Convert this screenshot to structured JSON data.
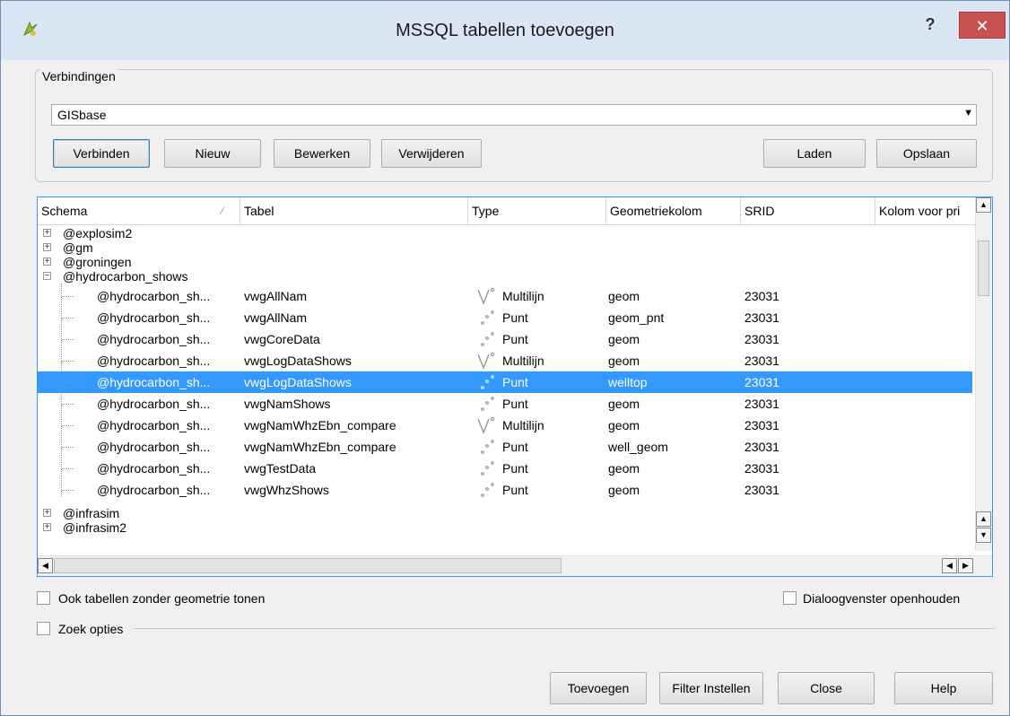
{
  "window": {
    "title": "MSSQL tabellen toevoegen",
    "help_label": "?",
    "close_label": "✕"
  },
  "connections": {
    "legend": "Verbindingen",
    "selected": "GISbase",
    "buttons": {
      "connect": "Verbinden",
      "new": "Nieuw",
      "edit": "Bewerken",
      "delete": "Verwijderen",
      "load": "Laden",
      "save": "Opslaan"
    }
  },
  "table": {
    "columns": [
      "Schema",
      "Tabel",
      "Type",
      "Geometriekolom",
      "SRID",
      "Kolom voor pri"
    ],
    "groups_before": [
      "@explosim2",
      "@gm",
      "@groningen"
    ],
    "expanded_group": "@hydrocarbon_shows",
    "rows": [
      {
        "schema": "@hydrocarbon_sh...",
        "tabel": "vwgAllNam",
        "type": "Multilijn",
        "icon": "multiline-icon",
        "geom": "geom",
        "srid": "23031",
        "selected": false
      },
      {
        "schema": "@hydrocarbon_sh...",
        "tabel": "vwgAllNam",
        "type": "Punt",
        "icon": "point-icon",
        "geom": "geom_pnt",
        "srid": "23031",
        "selected": false
      },
      {
        "schema": "@hydrocarbon_sh...",
        "tabel": "vwgCoreData",
        "type": "Punt",
        "icon": "point-icon",
        "geom": "geom",
        "srid": "23031",
        "selected": false
      },
      {
        "schema": "@hydrocarbon_sh...",
        "tabel": "vwgLogDataShows",
        "type": "Multilijn",
        "icon": "multiline-icon",
        "geom": "geom",
        "srid": "23031",
        "selected": false
      },
      {
        "schema": "@hydrocarbon_sh...",
        "tabel": "vwgLogDataShows",
        "type": "Punt",
        "icon": "point-icon",
        "geom": "welltop",
        "srid": "23031",
        "selected": true
      },
      {
        "schema": "@hydrocarbon_sh...",
        "tabel": "vwgNamShows",
        "type": "Punt",
        "icon": "point-icon",
        "geom": "geom",
        "srid": "23031",
        "selected": false
      },
      {
        "schema": "@hydrocarbon_sh...",
        "tabel": "vwgNamWhzEbn_compare",
        "type": "Multilijn",
        "icon": "multiline-icon",
        "geom": "geom",
        "srid": "23031",
        "selected": false
      },
      {
        "schema": "@hydrocarbon_sh...",
        "tabel": "vwgNamWhzEbn_compare",
        "type": "Punt",
        "icon": "point-icon",
        "geom": "well_geom",
        "srid": "23031",
        "selected": false
      },
      {
        "schema": "@hydrocarbon_sh...",
        "tabel": "vwgTestData",
        "type": "Punt",
        "icon": "point-icon",
        "geom": "geom",
        "srid": "23031",
        "selected": false
      },
      {
        "schema": "@hydrocarbon_sh...",
        "tabel": "vwgWhzShows",
        "type": "Punt",
        "icon": "point-icon",
        "geom": "geom",
        "srid": "23031",
        "selected": false
      }
    ],
    "groups_after": [
      "@infrasim",
      "@infrasim2"
    ]
  },
  "options": {
    "no_geometry_label": "Ook tabellen zonder geometrie tonen",
    "keep_open_label": "Dialoogvenster openhouden",
    "search_options_label": "Zoek opties"
  },
  "footer": {
    "add": "Toevoegen",
    "filter": "Filter Instellen",
    "close": "Close",
    "help": "Help"
  },
  "colors": {
    "selection": "#3399ff",
    "close_button": "#c75050"
  }
}
